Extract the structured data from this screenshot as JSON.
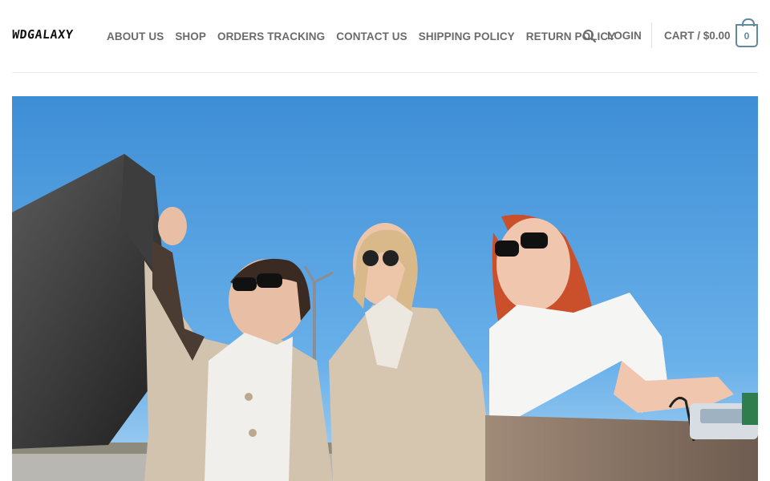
{
  "brand": {
    "logo_text": "WDGALAXY"
  },
  "nav": {
    "items": [
      {
        "label": "ABOUT US"
      },
      {
        "label": "SHOP"
      },
      {
        "label": "ORDERS TRACKING"
      },
      {
        "label": "CONTACT US"
      },
      {
        "label": "SHIPPING POLICY"
      },
      {
        "label": "RETURN POLICY"
      }
    ],
    "search_icon": "search-icon",
    "login_label": "LOGIN"
  },
  "cart": {
    "label": "CART / $0.00",
    "count": "0",
    "accent_color": "#5f8aa0"
  },
  "hero": {
    "image_description_icon": "hero-photo",
    "sky_color": "#4a97d8"
  }
}
